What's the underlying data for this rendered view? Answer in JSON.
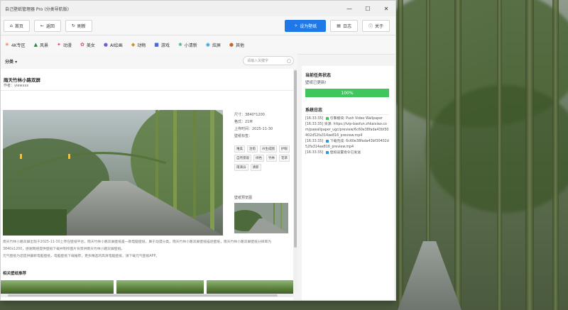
{
  "window": {
    "title": "自己壁纸管理器 Pro (分类导航版)",
    "min": "—",
    "max": "☐",
    "close": "✕"
  },
  "toolbar": {
    "home": "首页",
    "back": "返回",
    "refresh": "刷新",
    "set_wallpaper": "设为壁纸",
    "log": "日志",
    "about": "关于"
  },
  "categories": [
    {
      "icon": "✳",
      "label": "4K专区",
      "color": "#e05a2a"
    },
    {
      "icon": "▲",
      "label": "风景",
      "color": "#2a8a3c"
    },
    {
      "icon": "✦",
      "label": "动漫",
      "color": "#e0408a"
    },
    {
      "icon": "✿",
      "label": "美女",
      "color": "#d8505f"
    },
    {
      "icon": "●",
      "label": "AI绘画",
      "color": "#7a58d8"
    },
    {
      "icon": "◆",
      "label": "动物",
      "color": "#d98b23"
    },
    {
      "icon": "■",
      "label": "游戏",
      "color": "#4a6ad8"
    },
    {
      "icon": "❀",
      "label": "小清新",
      "color": "#3aa86a"
    },
    {
      "icon": "◉",
      "label": "炫屏",
      "color": "#2a9ad8"
    },
    {
      "icon": "●",
      "label": "其他",
      "color": "#c06a30"
    }
  ],
  "filter": {
    "sort_label": "分类 ▾",
    "search_placeholder": "请输入关键字"
  },
  "wallpaper": {
    "title": "雨天竹林小路双屏",
    "author": "作者：viewxxx",
    "size": "尺寸：3840*1200",
    "filesize": "格式：21M",
    "date": "上传时间：2025-11-30",
    "tags_label": "壁纸标签：",
    "tags": [
      "唯美",
      "治愈",
      "AI生成图",
      "护眼",
      "自然景观",
      "绿色",
      "竹林",
      "花草",
      "雨滴派",
      "清新"
    ],
    "preview_label": "壁纸预览图",
    "desc1": "雨天竹林小路双屏出现于2025-11-30上传在壁纸平台，雨天竹林小路双屏壁纸是一款电脑壁纸，属于动漫分类，雨天竹林小路双屏壁纸描述壁纸，雨天竹林小路双屏壁纸分辨率为3840x1200，感谢网络提供壁纸下载并制作图片背景供雨天竹林小路双屏壁纸。",
    "desc2": "元气壁纸为您提供最新电脑壁纸，电脑壁纸下载推荐，更多精选的高清电脑壁纸，请下载元气壁纸APP。",
    "related": "相关壁纸推荐"
  },
  "status": {
    "title": "当前任务状态",
    "text": "壁纸已更新!",
    "progress_percent": 100,
    "progress_label": "100%",
    "log_title": "系统日志",
    "log_lines": [
      {
        "text": "[16:33:35] ",
        "mark": "#3fc65c",
        "rest": "引擎模块: Push Video Wallpaper"
      },
      {
        "text": "[16:33:35] 资源: https://ivip-baofun.zhkaixiao.com/pawallpaper_ugc/preview/6c60e38fada43bf30402d52fa314ae816_preview.mp4",
        "mark": "",
        "rest": ""
      },
      {
        "text": "[16:33:35] ",
        "mark": "#2a9ad8",
        "rest": "下载完成: 6c60e38fada43bf30402d52fa314ae816_preview.mp4"
      },
      {
        "text": "[16:33:35] ",
        "mark": "#2a9ad8",
        "rest": "壁纸设置指令已发送"
      }
    ]
  }
}
